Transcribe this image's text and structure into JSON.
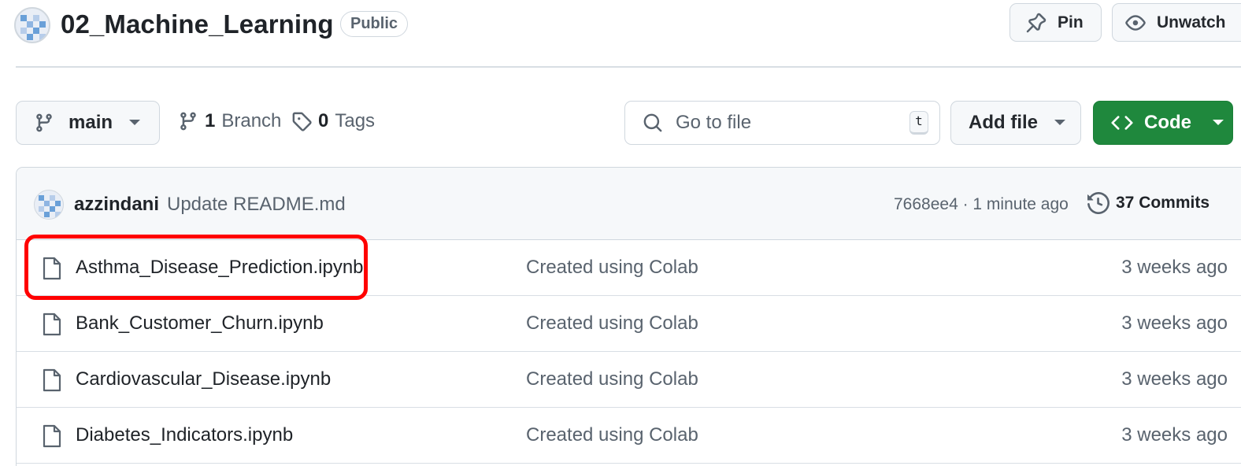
{
  "header": {
    "repo_name": "02_Machine_Learning",
    "visibility": "Public",
    "pin_label": "Pin",
    "watch_label": "Unwatch"
  },
  "toolbar": {
    "branch_name": "main",
    "branch_count": "1",
    "branch_word": "Branch",
    "tag_count": "0",
    "tag_word": "Tags",
    "go_to_file_placeholder": "Go to file",
    "shortcut_key": "t",
    "add_file_label": "Add file",
    "code_label": "Code"
  },
  "latest_commit": {
    "author": "azzindani",
    "message": "Update README.md",
    "hash_and_time": "7668ee4 · 1 minute ago",
    "commits_label": "37 Commits"
  },
  "files": [
    {
      "name": "Asthma_Disease_Prediction.ipynb",
      "message": "Created using Colab",
      "date": "3 weeks ago"
    },
    {
      "name": "Bank_Customer_Churn.ipynb",
      "message": "Created using Colab",
      "date": "3 weeks ago"
    },
    {
      "name": "Cardiovascular_Disease.ipynb",
      "message": "Created using Colab",
      "date": "3 weeks ago"
    },
    {
      "name": "Diabetes_Indicators.ipynb",
      "message": "Created using Colab",
      "date": "3 weeks ago"
    }
  ],
  "colors": {
    "code_button": "#1f883d",
    "highlight": "#ff0000",
    "border": "#d0d7de"
  }
}
